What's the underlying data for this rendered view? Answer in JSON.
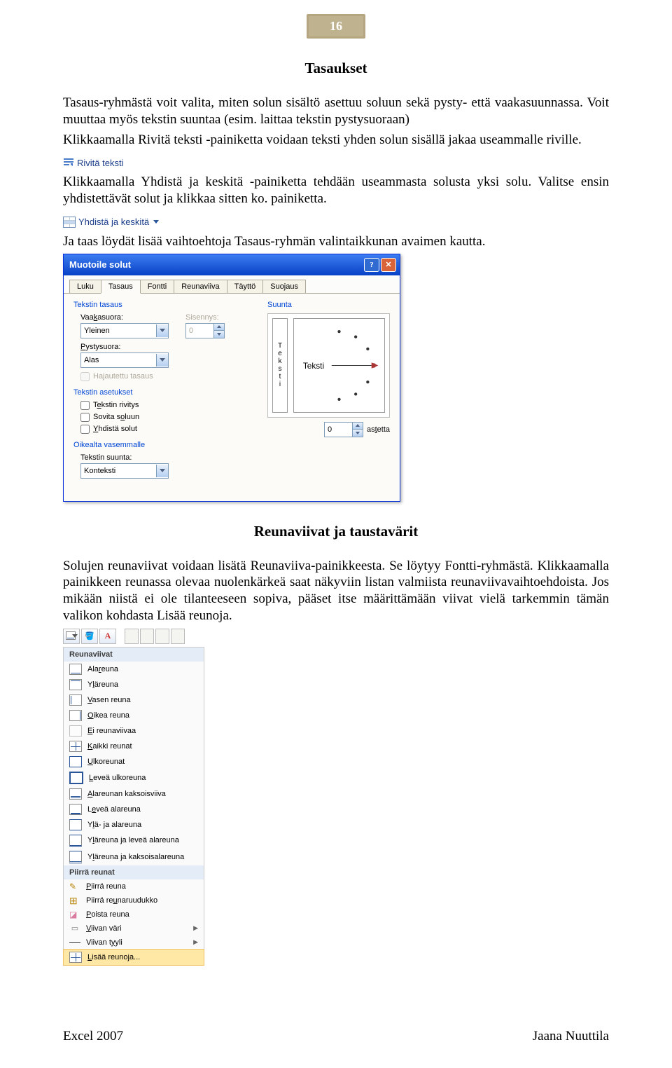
{
  "pageNumber": "16",
  "h1": "Tasaukset",
  "p1": "Tasaus-ryhmästä voit valita, miten solun sisältö asettuu soluun sekä pysty- että vaakasuunnassa. Voit muuttaa myös tekstin suuntaa (esim. laittaa tekstin pystysuoraan)",
  "p1b": "Klikkaamalla  Rivitä teksti -painiketta voidaan teksti yhden solun sisällä jakaa useammalle riville.",
  "rivita": "Rivitä teksti",
  "p2": "Klikkaamalla Yhdistä ja keskitä -painiketta tehdään useammasta solusta yksi solu. Valitse ensin yhdistettävät solut ja klikkaa sitten ko. painiketta.",
  "yhdista": "Yhdistä ja keskitä",
  "p3": "Ja taas löydät lisää vaihtoehtoja Tasaus-ryhmän valintaikkunan avaimen kautta.",
  "dialog": {
    "title": "Muotoile solut",
    "tabs": [
      "Luku",
      "Tasaus",
      "Fontti",
      "Reunaviiva",
      "Täyttö",
      "Suojaus"
    ],
    "group_align": "Tekstin tasaus",
    "lbl_h": "Vaakasuora:",
    "val_h": "Yleinen",
    "lbl_indent": "Sisennys:",
    "val_indent": "0",
    "lbl_v": "Pystysuora:",
    "val_v": "Alas",
    "cb_just": "Hajautettu tasaus",
    "group_set": "Tekstin asetukset",
    "cb_wrap": "Tekstin rivitys",
    "cb_shrink": "Sovita soluun",
    "cb_merge": "Yhdistä solut",
    "group_rtl": "Oikealta vasemmalle",
    "lbl_dir": "Tekstin suunta:",
    "val_dir": "Konteksti",
    "group_ori": "Suunta",
    "vtext": "Teksti",
    "arclabel": "Teksti",
    "deg_val": "0",
    "deg_lbl": "astetta"
  },
  "h2": "Reunaviivat ja taustavärit",
  "p4": "Solujen reunaviivat voidaan lisätä Reunaviiva-painikkeesta. Se löytyy Fontti-ryhmästä. Klikkaamalla painikkeen reunassa olevaa nuolenkärkeä saat näkyviin listan valmiista reunaviivavaihtoehdoista. Jos mikään niistä ei ole tilanteeseen sopiva, pääset itse määrittämään viivat vielä tarkemmin tämän valikon kohdasta Lisää reunoja.",
  "borders": {
    "head1": "Reunaviivat",
    "items": [
      {
        "ic": "bot",
        "t": "Alareuna",
        "u": "r"
      },
      {
        "ic": "top",
        "t": "Yläreuna",
        "u": "l"
      },
      {
        "ic": "lft",
        "t": "Vasen reuna",
        "u": "V"
      },
      {
        "ic": "rgt",
        "t": "Oikea reuna",
        "u": "O"
      },
      {
        "ic": "none",
        "t": "Ei reunaviivaa",
        "u": "E"
      },
      {
        "ic": "all",
        "t": "Kaikki reunat",
        "u": "K"
      },
      {
        "ic": "out",
        "t": "Ulkoreunat",
        "u": "U"
      },
      {
        "ic": "thick",
        "t": "Leveä ulkoreuna",
        "u": "L"
      },
      {
        "ic": "dbl",
        "t": "Alareunan kaksoisviiva",
        "u": "A"
      },
      {
        "ic": "tbot",
        "t": "Leveä alareuna",
        "u": "e"
      },
      {
        "ic": "topbot",
        "t": "Ylä- ja alareuna",
        "u": "l"
      },
      {
        "ic": "topbotT",
        "t": "Yläreuna ja leveä alareuna",
        "u": "l"
      },
      {
        "ic": "topDbl",
        "t": "Yläreuna ja kaksoisalareuna",
        "u": "l"
      }
    ],
    "head2": "Piirrä reunat",
    "draw": [
      {
        "ic": "pen",
        "t": "Piirrä reuna",
        "u": "P"
      },
      {
        "ic": "grid",
        "t": "Piirrä reunaruudukko",
        "u": "u"
      },
      {
        "ic": "eras",
        "t": "Poista reuna",
        "u": "P"
      },
      {
        "ic": "pal",
        "t": "Viivan väri",
        "u": "V",
        "arrow": true
      },
      {
        "ic": "line",
        "t": "Viivan tyyli",
        "u": "y",
        "arrow": true
      }
    ],
    "more": "Lisää reunoja..."
  },
  "footer_l": "Excel 2007",
  "footer_r": "Jaana Nuuttila"
}
